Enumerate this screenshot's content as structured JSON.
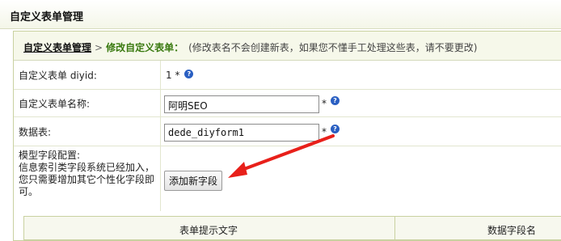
{
  "header": {
    "title": "自定义表单管理"
  },
  "breadcrumb": {
    "parent": "自定义表单管理",
    "separator": ">",
    "current": "修改自定义表单：",
    "note": "(修改表名不会创建新表，如果您不懂手工处理这些表，请不要更改)"
  },
  "form": {
    "diyid_label": "自定义表单 diyid:",
    "diyid_value": "1",
    "required_mark": "*",
    "name_label": "自定义表单名称:",
    "name_value": "阿明SEO",
    "table_label": "数据表:",
    "table_value": "dede_diyform1",
    "fields_label": "模型字段配置:",
    "fields_desc": "信息索引类字段系统已经加入，您只需要增加其它个性化字段即可。",
    "add_field_button": "添加新字段"
  },
  "fields_table": {
    "columns": [
      "表单提示文字",
      "数据字段名"
    ]
  },
  "icons": {
    "help": "help-icon",
    "annotation": "red-arrow"
  },
  "colors": {
    "accent_green": "#3a7a10",
    "arrow_red": "#e8201a",
    "help_blue": "#2a5fc2"
  }
}
